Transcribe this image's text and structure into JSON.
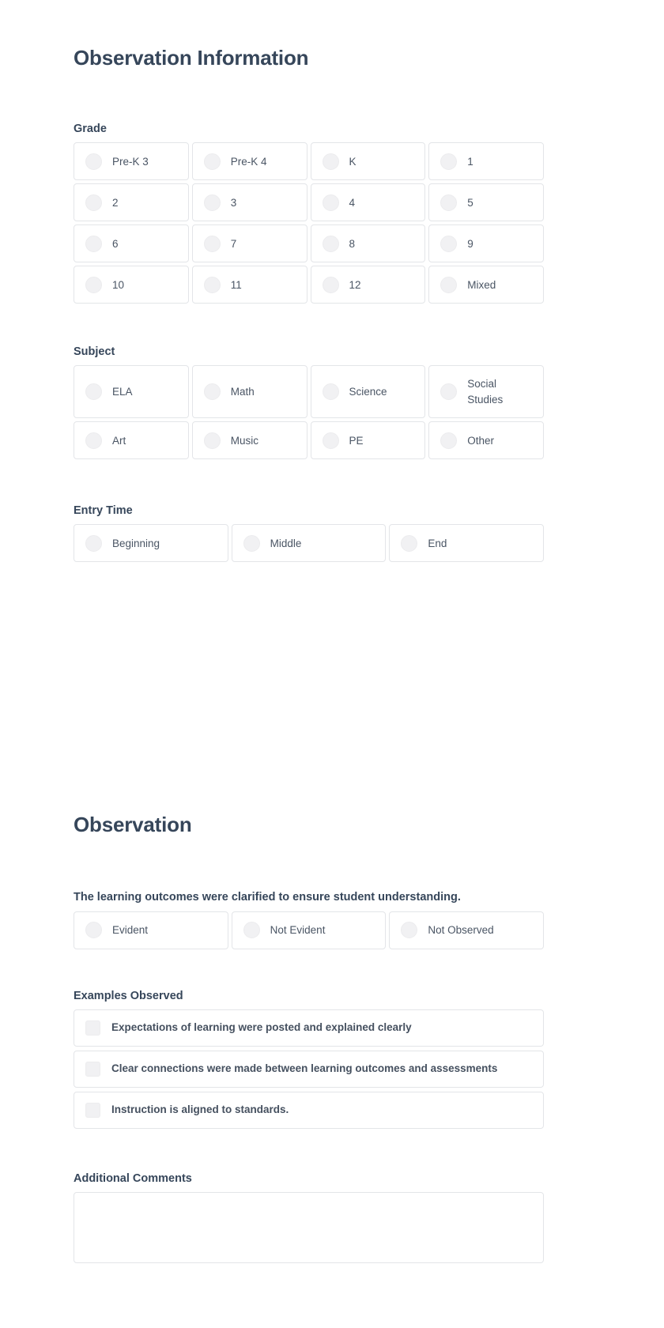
{
  "sections": {
    "observation_information": {
      "title": "Observation Information",
      "grade": {
        "label": "Grade",
        "options": [
          "Pre-K 3",
          "Pre-K 4",
          "K",
          "1",
          "2",
          "3",
          "4",
          "5",
          "6",
          "7",
          "8",
          "9",
          "10",
          "11",
          "12",
          "Mixed"
        ]
      },
      "subject": {
        "label": "Subject",
        "options_row1": [
          "ELA",
          "Math",
          "Science",
          "Social Studies"
        ],
        "options_row2": [
          "Art",
          "Music",
          "PE",
          "Other"
        ]
      },
      "entry_time": {
        "label": "Entry Time",
        "options": [
          "Beginning",
          "Middle",
          "End"
        ]
      }
    },
    "observation": {
      "title": "Observation",
      "question": {
        "text": "The learning outcomes were clarified to ensure student understanding.",
        "options": [
          "Evident",
          "Not Evident",
          "Not Observed"
        ]
      },
      "examples_observed": {
        "label": "Examples Observed",
        "items": [
          "Expectations of learning were posted and explained clearly",
          "Clear connections were made between learning outcomes and assessments",
          "Instruction is aligned to standards."
        ]
      },
      "additional_comments": {
        "label": "Additional Comments",
        "value": "",
        "placeholder": ""
      }
    }
  },
  "colors": {
    "heading": "#36465a",
    "body_text": "#4a5564",
    "border": "#e3e5e8",
    "control_fill": "#f1f1f3",
    "background": "#ffffff"
  }
}
